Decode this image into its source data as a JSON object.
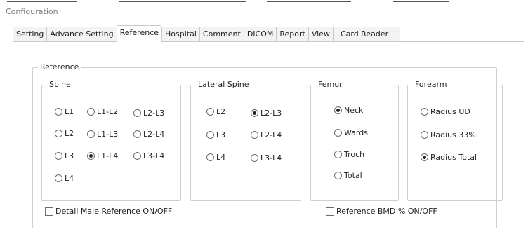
{
  "window": {
    "title": "Configuration"
  },
  "tabs": [
    {
      "label": "Setting",
      "active": false
    },
    {
      "label": "Advance Setting",
      "active": false
    },
    {
      "label": "Reference",
      "active": true
    },
    {
      "label": "Hospital",
      "active": false
    },
    {
      "label": "Comment",
      "active": false
    },
    {
      "label": "DICOM",
      "active": false
    },
    {
      "label": "Report",
      "active": false
    },
    {
      "label": "View",
      "active": false
    },
    {
      "label": "Card Reader",
      "active": false
    }
  ],
  "reference": {
    "title": "Reference",
    "spine": {
      "title": "Spine",
      "options": [
        {
          "label": "L1",
          "checked": false
        },
        {
          "label": "L1-L2",
          "checked": false
        },
        {
          "label": "L2-L3",
          "checked": false
        },
        {
          "label": "L2",
          "checked": false
        },
        {
          "label": "L1-L3",
          "checked": false
        },
        {
          "label": "L2-L4",
          "checked": false
        },
        {
          "label": "L3",
          "checked": false
        },
        {
          "label": "L1-L4",
          "checked": true
        },
        {
          "label": "L3-L4",
          "checked": false
        },
        {
          "label": "L4",
          "checked": false
        }
      ]
    },
    "lateral_spine": {
      "title": "Lateral Spine",
      "options": [
        {
          "label": "L2",
          "checked": false
        },
        {
          "label": "L2-L3",
          "checked": true
        },
        {
          "label": "L3",
          "checked": false
        },
        {
          "label": "L2-L4",
          "checked": false
        },
        {
          "label": "L4",
          "checked": false
        },
        {
          "label": "L3-L4",
          "checked": false
        }
      ]
    },
    "femur": {
      "title": "Femur",
      "options": [
        {
          "label": "Neck",
          "checked": true
        },
        {
          "label": "Wards",
          "checked": false
        },
        {
          "label": "Troch",
          "checked": false
        },
        {
          "label": "Total",
          "checked": false
        }
      ]
    },
    "forearm": {
      "title": "Forearm",
      "options": [
        {
          "label": "Radius UD",
          "checked": false
        },
        {
          "label": "Radius 33%",
          "checked": false
        },
        {
          "label": "Radius Total",
          "checked": true
        }
      ]
    },
    "detail_male": {
      "label": "Detail Male Reference ON/OFF",
      "checked": false
    },
    "bmd_percent": {
      "label": "Reference BMD % ON/OFF",
      "checked": false
    }
  }
}
